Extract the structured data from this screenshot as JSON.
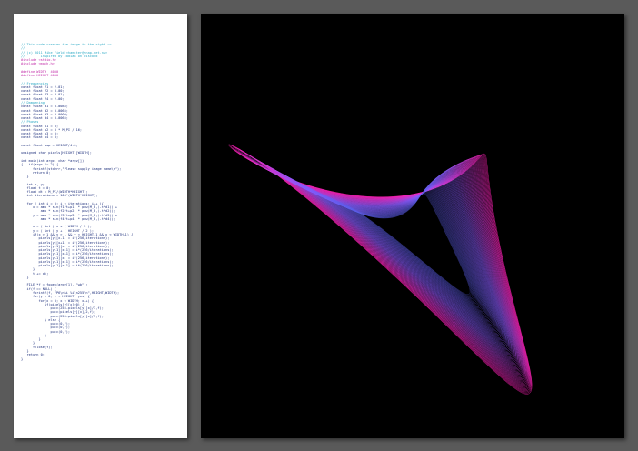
{
  "code_panel": {
    "lines": [
      {
        "text": "// This code creates the image to the right =>",
        "kind": "comment"
      },
      {
        "text": "//",
        "kind": "comment"
      },
      {
        "text": "// (c) 2011 Mike Field <hamster@snap.net.nz>",
        "kind": "comment"
      },
      {
        "text": "//        Inspired by Zadian on Discord",
        "kind": "comment"
      },
      {
        "text": "#include <stdio.h>",
        "kind": "pre"
      },
      {
        "text": "#include <math.h>",
        "kind": "pre"
      },
      {
        "text": "",
        "kind": "blank"
      },
      {
        "text": "#define WIDTH  4000",
        "kind": "pre"
      },
      {
        "text": "#define HEIGHT 4000",
        "kind": "pre"
      },
      {
        "text": "",
        "kind": "blank"
      },
      {
        "text": "// Frequencies",
        "kind": "comment"
      },
      {
        "text": "const float f1 = 2.01;",
        "kind": "code"
      },
      {
        "text": "const float f2 = 3.00;",
        "kind": "code"
      },
      {
        "text": "const float f3 = 3.01;",
        "kind": "code"
      },
      {
        "text": "const float f4 = 2.00;",
        "kind": "code"
      },
      {
        "text": "// Dampening",
        "kind": "comment"
      },
      {
        "text": "const float d1 = 0.0085;",
        "kind": "code"
      },
      {
        "text": "const float d2 = 0.0065;",
        "kind": "code"
      },
      {
        "text": "const float d3 = 0.0000;",
        "kind": "code"
      },
      {
        "text": "const float d4 = 0.0065;",
        "kind": "code"
      },
      {
        "text": "// Phases",
        "kind": "comment"
      },
      {
        "text": "const float p1 = 0;",
        "kind": "code"
      },
      {
        "text": "const float p2 = 0 * M_PI / 16;",
        "kind": "code"
      },
      {
        "text": "const float p3 = 0;",
        "kind": "code"
      },
      {
        "text": "const float p4 = 0;",
        "kind": "code"
      },
      {
        "text": "",
        "kind": "blank"
      },
      {
        "text": "const float amp = HEIGHT/4.0;",
        "kind": "code"
      },
      {
        "text": "",
        "kind": "blank"
      },
      {
        "text": "unsigned char pixels[HEIGHT][WIDTH];",
        "kind": "code"
      },
      {
        "text": "",
        "kind": "blank"
      },
      {
        "text": "int main(int argc, char *argv[])",
        "kind": "code"
      },
      {
        "text": "{   if(argc != 2) {",
        "kind": "code"
      },
      {
        "text": "      fprintf(stderr,\"Please supply image name\\n\");",
        "kind": "code"
      },
      {
        "text": "      return 0;",
        "kind": "code"
      },
      {
        "text": "   }",
        "kind": "code"
      },
      {
        "text": "",
        "kind": "blank"
      },
      {
        "text": "   int x, y;",
        "kind": "code"
      },
      {
        "text": "   float t = 0;",
        "kind": "code"
      },
      {
        "text": "   float dt = M_PI/(WIDTH*HEIGHT);",
        "kind": "code"
      },
      {
        "text": "   int iterations = 100*(WIDTH*HEIGHT);",
        "kind": "code"
      },
      {
        "text": "",
        "kind": "blank"
      },
      {
        "text": "   for ( int i = 0; i < iterations; i++ ){",
        "kind": "code"
      },
      {
        "text": "      x = amp * sin(f1*t+p1) * pow(M_E,(-t*d1)) +",
        "kind": "code"
      },
      {
        "text": "          amp * sin(f2*t+p2) * pow(M_E,(-t*d2));",
        "kind": "code"
      },
      {
        "text": "      y = amp * sin(f3*t+p3) * pow(M_E,(-t*d3)) +",
        "kind": "code"
      },
      {
        "text": "          amp * sin(f4*t+p4) * pow(M_E,(-t*d4));",
        "kind": "code"
      },
      {
        "text": "",
        "kind": "blank"
      },
      {
        "text": "      x = ( int ) x + ( WIDTH / 2 );",
        "kind": "code"
      },
      {
        "text": "      y = ( int ) y + ( HEIGHT / 2 );",
        "kind": "code"
      },
      {
        "text": "      if(x > 1 && y > 1 && y < HEIGHT-1 && x < WIDTH-1) {",
        "kind": "code"
      },
      {
        "text": "         pixels[y][x-1] = i*(256/iterations);",
        "kind": "code"
      },
      {
        "text": "         pixels[y][x+1] = i*(256/iterations);",
        "kind": "code"
      },
      {
        "text": "         pixels[y-1][x] = i*(256/iterations);",
        "kind": "code"
      },
      {
        "text": "         pixels[y-1][x-1] = i*(256/iterations);",
        "kind": "code"
      },
      {
        "text": "         pixels[y-1][x+1] = i*(256/iterations);",
        "kind": "code"
      },
      {
        "text": "         pixels[y+1][x] = i*(256/iterations);",
        "kind": "code"
      },
      {
        "text": "         pixels[y+1][x-1] = i*(256/iterations);",
        "kind": "code"
      },
      {
        "text": "         pixels[y+1][x+1] = i*(256/iterations);",
        "kind": "code"
      },
      {
        "text": "      }",
        "kind": "code"
      },
      {
        "text": "      t += dt;",
        "kind": "code"
      },
      {
        "text": "   }",
        "kind": "code"
      },
      {
        "text": "",
        "kind": "blank"
      },
      {
        "text": "   FILE *f = fopen(argv[1], \"wb\");",
        "kind": "code"
      },
      {
        "text": "   if(f == NULL) {",
        "kind": "code"
      },
      {
        "text": "      fprintf(f, \"P6\\n%i %i\\n255\\n\",HEIGHT,WIDTH);",
        "kind": "code"
      },
      {
        "text": "      for(y = 0; y < HEIGHT; y++) {",
        "kind": "code"
      },
      {
        "text": "         for(x = 0; x < WIDTH; x++) {",
        "kind": "code"
      },
      {
        "text": "            if(pixels[y][x]>0) {",
        "kind": "code"
      },
      {
        "text": "               putc(255-pixels[y][x]/3,f);",
        "kind": "code"
      },
      {
        "text": "               putc(pixels[y][x]/2,f);",
        "kind": "code"
      },
      {
        "text": "               putc(255-pixels[y][x]/3,f);",
        "kind": "code"
      },
      {
        "text": "            } else {",
        "kind": "code"
      },
      {
        "text": "               putc(0,f);",
        "kind": "code"
      },
      {
        "text": "               putc(0,f);",
        "kind": "code"
      },
      {
        "text": "               putc(0,f);",
        "kind": "code"
      },
      {
        "text": "            }",
        "kind": "code"
      },
      {
        "text": "         }",
        "kind": "code"
      },
      {
        "text": "      }",
        "kind": "code"
      },
      {
        "text": "      fclose(f);",
        "kind": "code"
      },
      {
        "text": "   }",
        "kind": "code"
      },
      {
        "text": "   return 0;",
        "kind": "code"
      },
      {
        "text": "}",
        "kind": "code"
      }
    ]
  },
  "art_panel": {
    "background": "#000000",
    "colors": {
      "magenta": "#ff1fb4",
      "violet": "#8a5cff",
      "blue": "#5a5ee8"
    }
  },
  "colors": {
    "desktop": "#5a5a5a",
    "page": "#ffffff"
  }
}
